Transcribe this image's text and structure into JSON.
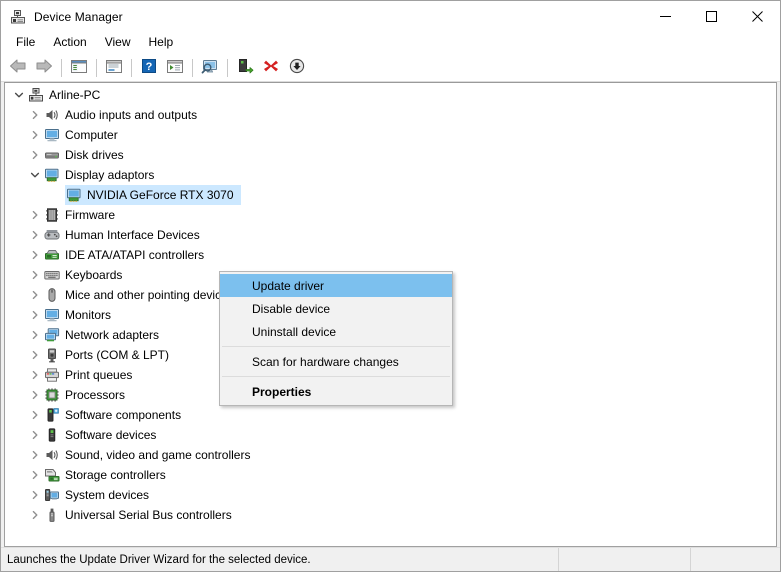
{
  "window": {
    "title": "Device Manager",
    "title_icon": "device-manager-icon",
    "controls": [
      {
        "name": "minimize-button",
        "glyph": "minimize-icon"
      },
      {
        "name": "maximize-button",
        "glyph": "maximize-icon"
      },
      {
        "name": "close-button",
        "glyph": "close-icon"
      }
    ]
  },
  "menubar": {
    "items": [
      {
        "label": "File",
        "name": "menu-file"
      },
      {
        "label": "Action",
        "name": "menu-action"
      },
      {
        "label": "View",
        "name": "menu-view"
      },
      {
        "label": "Help",
        "name": "menu-help"
      }
    ]
  },
  "toolbar": {
    "buttons": [
      {
        "name": "back-button",
        "icon": "back-arrow-icon"
      },
      {
        "name": "forward-button",
        "icon": "forward-arrow-icon"
      },
      {
        "name": "separator-1",
        "icon": "separator"
      },
      {
        "name": "show-hide-console-tree-button",
        "icon": "console-tree-icon"
      },
      {
        "name": "separator-2",
        "icon": "separator"
      },
      {
        "name": "properties-button",
        "icon": "properties-window-icon"
      },
      {
        "name": "separator-3",
        "icon": "separator"
      },
      {
        "name": "help-button",
        "icon": "help-question-icon"
      },
      {
        "name": "show-hidden-devices-button",
        "icon": "device-list-icon"
      },
      {
        "name": "separator-4",
        "icon": "separator"
      },
      {
        "name": "scan-hardware-changes-button",
        "icon": "scan-monitor-icon"
      },
      {
        "name": "separator-5",
        "icon": "separator"
      },
      {
        "name": "update-driver-button",
        "icon": "update-driver-icon"
      },
      {
        "name": "uninstall-device-button",
        "icon": "red-x-icon"
      },
      {
        "name": "disable-device-button",
        "icon": "down-arrow-circle-icon"
      }
    ]
  },
  "tree": {
    "root": {
      "label": "Arline-PC",
      "icon": "computer-root-icon",
      "expanded": true,
      "twisty": "chevron-down-icon"
    },
    "nodes": [
      {
        "label": "Audio inputs and outputs",
        "icon": "speaker-icon",
        "expanded": false,
        "twisty": "chevron-right-icon",
        "selected": false,
        "depth": 1
      },
      {
        "label": "Computer",
        "icon": "monitor-icon",
        "expanded": false,
        "twisty": "chevron-right-icon",
        "selected": false,
        "depth": 1
      },
      {
        "label": "Disk drives",
        "icon": "disk-drive-icon",
        "expanded": false,
        "twisty": "chevron-right-icon",
        "selected": false,
        "depth": 1
      },
      {
        "label": "Display adaptors",
        "icon": "display-adapter-icon",
        "expanded": true,
        "twisty": "chevron-down-icon",
        "selected": false,
        "depth": 1
      },
      {
        "label": "NVIDIA GeForce RTX 3070",
        "icon": "display-adapter-icon",
        "expanded": false,
        "twisty": "none",
        "selected": true,
        "depth": 2
      },
      {
        "label": "Firmware",
        "icon": "firmware-chip-icon",
        "expanded": false,
        "twisty": "chevron-right-icon",
        "selected": false,
        "depth": 1
      },
      {
        "label": "Human Interface Devices",
        "icon": "gamepad-icon",
        "expanded": false,
        "twisty": "chevron-right-icon",
        "selected": false,
        "depth": 1
      },
      {
        "label": "IDE ATA/ATAPI controllers",
        "icon": "ide-controller-icon",
        "expanded": false,
        "twisty": "chevron-right-icon",
        "selected": false,
        "depth": 1
      },
      {
        "label": "Keyboards",
        "icon": "keyboard-icon",
        "expanded": false,
        "twisty": "chevron-right-icon",
        "selected": false,
        "depth": 1
      },
      {
        "label": "Mice and other pointing devices",
        "icon": "mouse-icon",
        "expanded": false,
        "twisty": "chevron-right-icon",
        "selected": false,
        "depth": 1
      },
      {
        "label": "Monitors",
        "icon": "monitor-icon",
        "expanded": false,
        "twisty": "chevron-right-icon",
        "selected": false,
        "depth": 1
      },
      {
        "label": "Network adapters",
        "icon": "network-adapter-icon",
        "expanded": false,
        "twisty": "chevron-right-icon",
        "selected": false,
        "depth": 1
      },
      {
        "label": "Ports (COM & LPT)",
        "icon": "port-icon",
        "expanded": false,
        "twisty": "chevron-right-icon",
        "selected": false,
        "depth": 1
      },
      {
        "label": "Print queues",
        "icon": "printer-icon",
        "expanded": false,
        "twisty": "chevron-right-icon",
        "selected": false,
        "depth": 1
      },
      {
        "label": "Processors",
        "icon": "processor-icon",
        "expanded": false,
        "twisty": "chevron-right-icon",
        "selected": false,
        "depth": 1
      },
      {
        "label": "Software components",
        "icon": "software-component-icon",
        "expanded": false,
        "twisty": "chevron-right-icon",
        "selected": false,
        "depth": 1
      },
      {
        "label": "Software devices",
        "icon": "software-device-icon",
        "expanded": false,
        "twisty": "chevron-right-icon",
        "selected": false,
        "depth": 1
      },
      {
        "label": "Sound, video and game controllers",
        "icon": "speaker-icon",
        "expanded": false,
        "twisty": "chevron-right-icon",
        "selected": false,
        "depth": 1
      },
      {
        "label": "Storage controllers",
        "icon": "storage-controller-icon",
        "expanded": false,
        "twisty": "chevron-right-icon",
        "selected": false,
        "depth": 1
      },
      {
        "label": "System devices",
        "icon": "system-device-icon",
        "expanded": false,
        "twisty": "chevron-right-icon",
        "selected": false,
        "depth": 1
      },
      {
        "label": "Universal Serial Bus controllers",
        "icon": "usb-icon",
        "expanded": false,
        "twisty": "chevron-right-icon",
        "selected": false,
        "depth": 1
      }
    ]
  },
  "context_menu": {
    "visible": true,
    "items": [
      {
        "label": "Update driver",
        "name": "ctx-update-driver",
        "highlighted": true,
        "bold": false
      },
      {
        "label": "Disable device",
        "name": "ctx-disable-device",
        "highlighted": false,
        "bold": false
      },
      {
        "label": "Uninstall device",
        "name": "ctx-uninstall-device",
        "highlighted": false,
        "bold": false
      },
      {
        "label": "__separator__",
        "name": "ctx-separator-1",
        "highlighted": false,
        "bold": false
      },
      {
        "label": "Scan for hardware changes",
        "name": "ctx-scan-hardware-changes",
        "highlighted": false,
        "bold": false
      },
      {
        "label": "__separator__",
        "name": "ctx-separator-2",
        "highlighted": false,
        "bold": false
      },
      {
        "label": "Properties",
        "name": "ctx-properties",
        "highlighted": false,
        "bold": true
      }
    ]
  },
  "statusbar": {
    "message": "Launches the Update Driver Wizard for the selected device.",
    "pane2": "",
    "pane3": ""
  },
  "colors": {
    "selection": "#cce8ff",
    "menu_highlight": "#7cc0ee",
    "window_bg": "#f0f0f0",
    "content_bg": "#ffffff",
    "accent_red": "#d42020",
    "accent_green": "#4ba82e",
    "accent_blue": "#3a8fd0"
  }
}
